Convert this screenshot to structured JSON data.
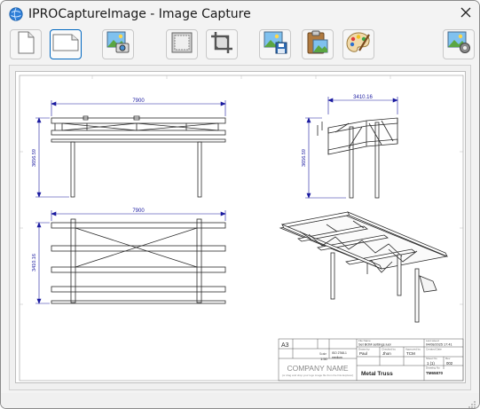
{
  "window": {
    "title": "IPROCaptureImage - Image Capture"
  },
  "icons": {
    "app": "app-globe-icon",
    "close": "close-icon",
    "toolbar": [
      "blank-page-icon",
      "landscape-page-icon",
      "capture-image-icon",
      "frame-border-icon",
      "crop-icon",
      "save-image-icon",
      "clipboard-image-icon",
      "paint-palette-icon",
      "image-settings-icon"
    ]
  },
  "toolbar": {
    "buttons": [
      {
        "name": "portrait-page",
        "tooltip": ""
      },
      {
        "name": "landscape-page",
        "tooltip": ""
      },
      {
        "name": "capture",
        "tooltip": ""
      },
      {
        "name": "frame",
        "tooltip": ""
      },
      {
        "name": "crop",
        "tooltip": ""
      },
      {
        "name": "save",
        "tooltip": ""
      },
      {
        "name": "clipboard",
        "tooltip": ""
      },
      {
        "name": "paint",
        "tooltip": ""
      },
      {
        "name": "settings",
        "tooltip": ""
      }
    ]
  },
  "drawing": {
    "dims": {
      "front_width": "7900",
      "front_height": "3656.59",
      "side_width": "3410.16",
      "side_height": "3656.59",
      "top_width": "7900",
      "top_height": "3410.16"
    },
    "title_block": {
      "sheet_size": "A3",
      "company_name": "COMPANY NAME",
      "company_hint": "(or drag and drop your logo image file from the File Explorer)",
      "file_name_label": "File Name",
      "file_name": "Set BOM settings.iuol",
      "last_saved_label": "Last saved",
      "last_saved": "04/08/2025 17:41",
      "drawn_by_label": "Drawn by",
      "drawn_by": "Paul",
      "checked_by_label": "Checked by",
      "checked_by": "Jhon",
      "approved_by_label": "Approved by",
      "approved_by": "TCM",
      "created_date_label": "Created Date",
      "sheet_label": "Sheet No",
      "sheet_value": "1 (1)",
      "rev_label": "Rev",
      "rev_value": "002",
      "scale_label": "Scale",
      "scale_value": "1:50",
      "standard_value": "ISO 2768-1",
      "tolerance_value": "medium",
      "title": "Metal Truss",
      "drawing_no": "TM65870",
      "drawing_no_label": "Drawing No"
    }
  },
  "colors": {
    "accent": "#0067c0",
    "dimension": "#1a1aa0",
    "line": "#2a2a2a"
  }
}
